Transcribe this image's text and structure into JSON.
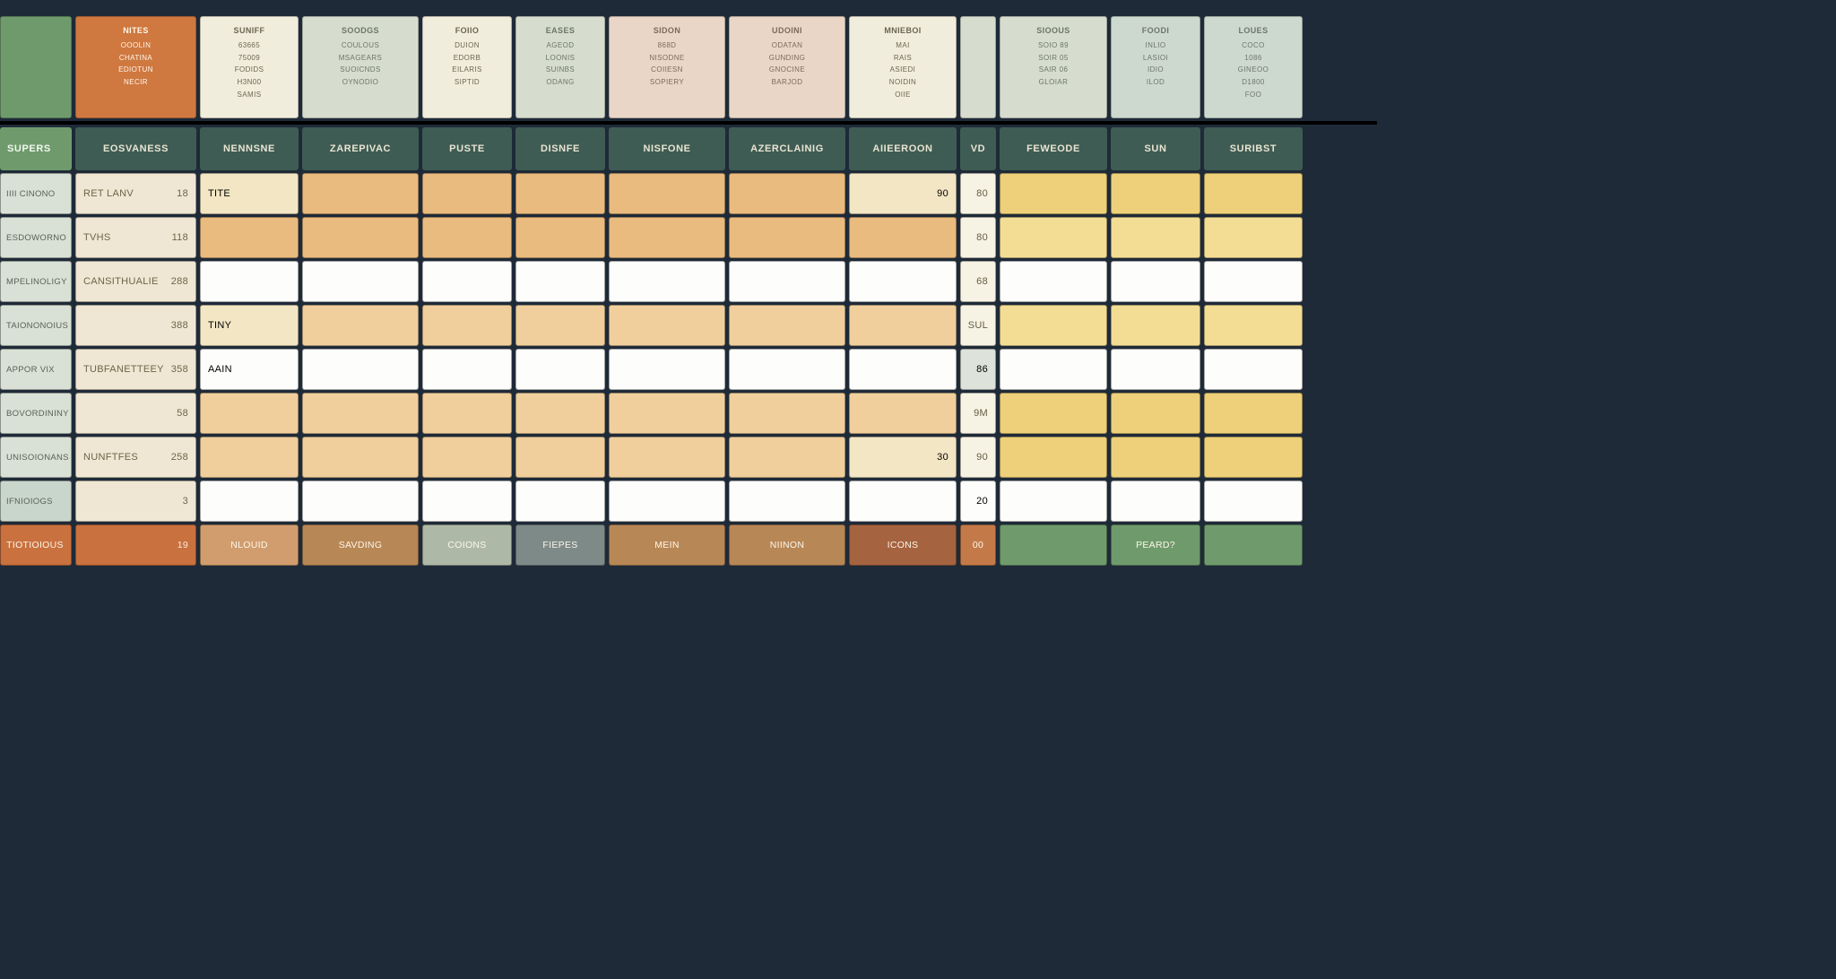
{
  "top": [
    {
      "style": "corner-green",
      "lines": []
    },
    {
      "style": "orange",
      "title": "NITES",
      "lines": [
        "OOOLIN",
        "CHATINA",
        "EDIOTUN",
        "NECIR"
      ]
    },
    {
      "style": "cream",
      "title": "SUNIFF",
      "lines": [
        "63665",
        "75009",
        "FODIDS",
        "H3N00",
        "SAMIS"
      ]
    },
    {
      "style": "sage",
      "title": "SOODGS",
      "lines": [
        "COULOUS",
        "MSAGEARS",
        "SUOICNDS",
        "OYNODIO"
      ]
    },
    {
      "style": "cream",
      "title": "FOIIO",
      "lines": [
        "DUION",
        "EDORB",
        "EILARIS",
        "SIPTID"
      ]
    },
    {
      "style": "sage",
      "title": "EASES",
      "lines": [
        "AGEOD",
        "LOONIS",
        "SUINBS",
        "ODANG"
      ]
    },
    {
      "style": "blush",
      "title": "SIDON",
      "lines": [
        "868D",
        "NISODNE",
        "COIIESN",
        "SOPIERY"
      ]
    },
    {
      "style": "blush",
      "title": "UDOINI",
      "lines": [
        "ODATAN",
        "GUNDING",
        "GNOCINE",
        "BARJOD"
      ]
    },
    {
      "style": "cream",
      "title": "MNIEBOI",
      "lines": [
        "MAI",
        "RAIS",
        "ASIEDI",
        "NOIDIN",
        "OIIE"
      ]
    },
    {
      "style": "sage",
      "title": "",
      "lines": []
    },
    {
      "style": "sage",
      "title": "SIOOUS",
      "lines": [
        "SOIO 89",
        "SOIR 05",
        "SAIR 06",
        "GLOIAR"
      ]
    },
    {
      "style": "mint",
      "title": "FOODI",
      "lines": [
        "INLIO",
        "LASIOI",
        "IDIO",
        "ILOD"
      ]
    },
    {
      "style": "mint",
      "title": "LOUES",
      "lines": [
        "COCO",
        "1086",
        "GINEOO",
        "D1800",
        "FOO"
      ]
    }
  ],
  "headers": {
    "side": "SUPERS",
    "cols": [
      "EOSVANESS",
      "NENNSNE",
      "ZAREPIVAC",
      "PUSTE",
      "DISNFE",
      "NISFONE",
      "AZERCLAINIG",
      "AIIEEROON",
      "VD",
      "FEWEODE",
      "SUN",
      "SURIBST"
    ]
  },
  "rows": [
    {
      "side": {
        "text": "IIII CINONO",
        "style": ""
      },
      "cat": {
        "name": "RET LANV",
        "val": "18"
      },
      "cells": [
        {
          "txt": "TITE",
          "cls": "fill-cream"
        },
        {
          "txt": "",
          "cls": "fill-peach"
        },
        {
          "txt": "",
          "cls": "fill-peach"
        },
        {
          "txt": "",
          "cls": "fill-peach"
        },
        {
          "txt": "",
          "cls": "fill-peach"
        },
        {
          "txt": "",
          "cls": "fill-peach"
        },
        {
          "txt": "90",
          "cls": "fill-cream num"
        },
        {
          "txt": "80",
          "cls": "small-num num"
        },
        {
          "txt": "",
          "cls": "fill-gold"
        },
        {
          "txt": "",
          "cls": "fill-gold"
        },
        {
          "txt": "",
          "cls": "fill-gold"
        }
      ]
    },
    {
      "side": {
        "text": "ESDOWORNO",
        "style": ""
      },
      "cat": {
        "name": "TVHS",
        "val": "118"
      },
      "cells": [
        {
          "txt": "",
          "cls": "fill-peach"
        },
        {
          "txt": "",
          "cls": "fill-peach"
        },
        {
          "txt": "",
          "cls": "fill-peach"
        },
        {
          "txt": "",
          "cls": "fill-peach"
        },
        {
          "txt": "",
          "cls": "fill-peach"
        },
        {
          "txt": "",
          "cls": "fill-peach"
        },
        {
          "txt": "",
          "cls": "fill-peach"
        },
        {
          "txt": "80",
          "cls": "small-num num"
        },
        {
          "txt": "",
          "cls": "fill-goldL"
        },
        {
          "txt": "",
          "cls": "fill-goldL"
        },
        {
          "txt": "",
          "cls": "fill-goldL"
        }
      ]
    },
    {
      "side": {
        "text": "MPELINOLIGY",
        "style": ""
      },
      "cat": {
        "name": "CANSITHUALIE",
        "val": "288"
      },
      "cells": [
        {
          "txt": "",
          "cls": "fill-white"
        },
        {
          "txt": "",
          "cls": "fill-white"
        },
        {
          "txt": "",
          "cls": "fill-white"
        },
        {
          "txt": "",
          "cls": "fill-white"
        },
        {
          "txt": "",
          "cls": "fill-white"
        },
        {
          "txt": "",
          "cls": "fill-white"
        },
        {
          "txt": "",
          "cls": "fill-white"
        },
        {
          "txt": "68",
          "cls": "small-num num"
        },
        {
          "txt": "",
          "cls": "fill-white"
        },
        {
          "txt": "",
          "cls": "fill-white"
        },
        {
          "txt": "",
          "cls": "fill-white"
        }
      ]
    },
    {
      "side": {
        "text": "TAIONONOIUS",
        "style": ""
      },
      "cat": {
        "name": "",
        "val": "388"
      },
      "cells": [
        {
          "txt": "TINY",
          "cls": "fill-cream"
        },
        {
          "txt": "",
          "cls": "fill-peachL"
        },
        {
          "txt": "",
          "cls": "fill-peachL"
        },
        {
          "txt": "",
          "cls": "fill-peachL"
        },
        {
          "txt": "",
          "cls": "fill-peachL"
        },
        {
          "txt": "",
          "cls": "fill-peachL"
        },
        {
          "txt": "",
          "cls": "fill-peachL"
        },
        {
          "txt": "SUL",
          "cls": "small-num num"
        },
        {
          "txt": "",
          "cls": "fill-goldL"
        },
        {
          "txt": "",
          "cls": "fill-goldL"
        },
        {
          "txt": "",
          "cls": "fill-goldL"
        }
      ]
    },
    {
      "side": {
        "text": "APPOR VIX",
        "style": ""
      },
      "cat": {
        "name": "TUBFANETTEEY",
        "val": "358"
      },
      "cells": [
        {
          "txt": "AAIN",
          "cls": "fill-white"
        },
        {
          "txt": "",
          "cls": "fill-white"
        },
        {
          "txt": "",
          "cls": "fill-white"
        },
        {
          "txt": "",
          "cls": "fill-white"
        },
        {
          "txt": "",
          "cls": "fill-white"
        },
        {
          "txt": "",
          "cls": "fill-white"
        },
        {
          "txt": "",
          "cls": "fill-white"
        },
        {
          "txt": "86",
          "cls": "fill-mint3 num"
        },
        {
          "txt": "",
          "cls": "fill-white"
        },
        {
          "txt": "",
          "cls": "fill-white"
        },
        {
          "txt": "",
          "cls": "fill-white"
        }
      ]
    },
    {
      "side": {
        "text": "BOVORDININY",
        "style": ""
      },
      "cat": {
        "name": "",
        "val": "58"
      },
      "cells": [
        {
          "txt": "",
          "cls": "fill-peachL"
        },
        {
          "txt": "",
          "cls": "fill-peachL"
        },
        {
          "txt": "",
          "cls": "fill-peachL"
        },
        {
          "txt": "",
          "cls": "fill-peachL"
        },
        {
          "txt": "",
          "cls": "fill-peachL"
        },
        {
          "txt": "",
          "cls": "fill-peachL"
        },
        {
          "txt": "",
          "cls": "fill-peachL"
        },
        {
          "txt": "9M",
          "cls": "small-num num"
        },
        {
          "txt": "",
          "cls": "fill-gold"
        },
        {
          "txt": "",
          "cls": "fill-gold"
        },
        {
          "txt": "",
          "cls": "fill-gold"
        }
      ]
    },
    {
      "side": {
        "text": "UNISOIONANS",
        "style": ""
      },
      "cat": {
        "name": "NUNFTFES",
        "val": "258"
      },
      "cells": [
        {
          "txt": "",
          "cls": "fill-peachL"
        },
        {
          "txt": "",
          "cls": "fill-peachL"
        },
        {
          "txt": "",
          "cls": "fill-peachL"
        },
        {
          "txt": "",
          "cls": "fill-peachL"
        },
        {
          "txt": "",
          "cls": "fill-peachL"
        },
        {
          "txt": "",
          "cls": "fill-peachL"
        },
        {
          "txt": "30",
          "cls": "fill-cream num"
        },
        {
          "txt": "90",
          "cls": "small-num num"
        },
        {
          "txt": "",
          "cls": "fill-gold"
        },
        {
          "txt": "",
          "cls": "fill-gold"
        },
        {
          "txt": "",
          "cls": "fill-gold"
        }
      ]
    },
    {
      "side": {
        "text": "IFNIOIOGS",
        "style": "mint2"
      },
      "cat": {
        "name": "",
        "val": "3"
      },
      "cells": [
        {
          "txt": "",
          "cls": "fill-white"
        },
        {
          "txt": "",
          "cls": "fill-white"
        },
        {
          "txt": "",
          "cls": "fill-white"
        },
        {
          "txt": "",
          "cls": "fill-white"
        },
        {
          "txt": "",
          "cls": "fill-white"
        },
        {
          "txt": "",
          "cls": "fill-white"
        },
        {
          "txt": "",
          "cls": "fill-white"
        },
        {
          "txt": "20",
          "cls": "fill-white num"
        },
        {
          "txt": "",
          "cls": "fill-white"
        },
        {
          "txt": "",
          "cls": "fill-white"
        },
        {
          "txt": "",
          "cls": "fill-white"
        }
      ]
    }
  ],
  "footer": {
    "side": {
      "text": "TIOTIOIOUS",
      "style": "orange2"
    },
    "cat": {
      "name": "",
      "val": "19"
    },
    "cells": [
      {
        "txt": "NLOUID",
        "cls": "fill-tanD"
      },
      {
        "txt": "SAVDING",
        "cls": "fill-brown"
      },
      {
        "txt": "COIONS",
        "cls": "fill-sage2"
      },
      {
        "txt": "FIEPES",
        "cls": "fill-slate"
      },
      {
        "txt": "MEIN",
        "cls": "fill-brown"
      },
      {
        "txt": "NIINON",
        "cls": "fill-brown"
      },
      {
        "txt": "ICONS",
        "cls": "fill-brownD"
      },
      {
        "txt": "00",
        "cls": "fill-rust num"
      },
      {
        "txt": "",
        "cls": "fill-green2"
      },
      {
        "txt": "PEARD?",
        "cls": "fill-green2"
      },
      {
        "txt": "",
        "cls": "fill-green2"
      }
    ]
  }
}
